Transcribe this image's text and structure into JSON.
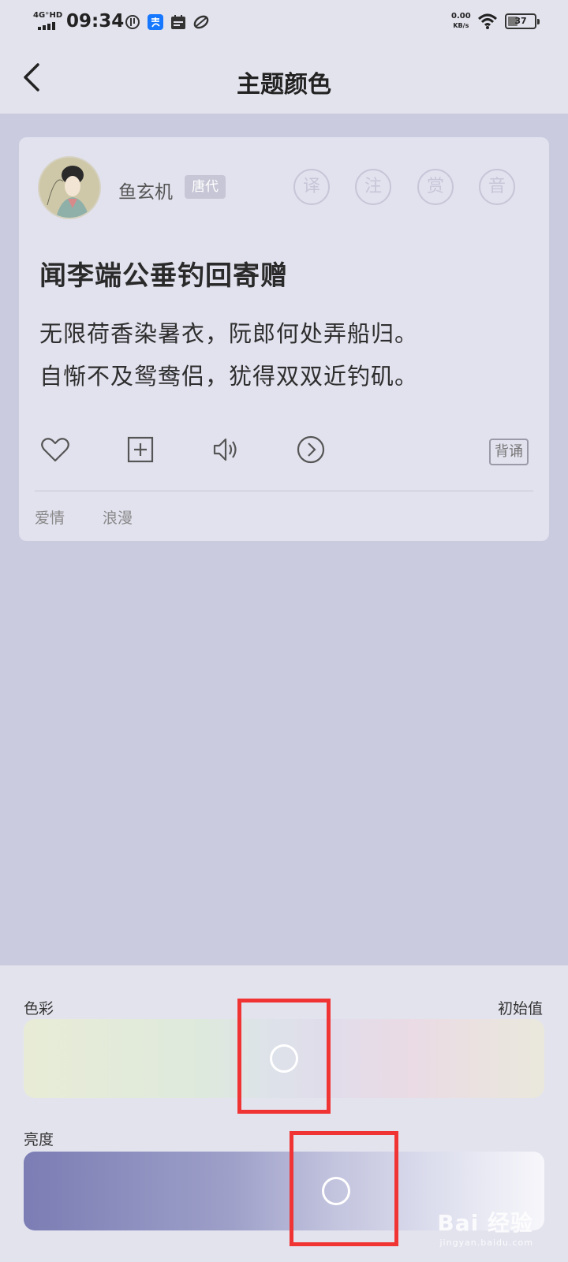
{
  "status_bar": {
    "network": "4G⁺HD",
    "time": "09:34",
    "net_speed_value": "0.00",
    "net_speed_unit": "KB/s",
    "battery": "37",
    "battery_level": 0.37,
    "icons": [
      "data-saver-icon",
      "alipay-icon",
      "calendar-icon",
      "app-icon",
      "wifi-icon",
      "battery-icon"
    ]
  },
  "nav": {
    "title": "主题颜色",
    "back_icon": "chevron-left-icon"
  },
  "card": {
    "author": "鱼玄机",
    "dynasty": "唐代",
    "tools": [
      "译",
      "注",
      "赏",
      "音"
    ],
    "poem_title": "闻李端公垂钓回寄赠",
    "lines": [
      "无限荷香染暑衣，阮郎何处弄船归。",
      "自惭不及鸳鸯侣，犹得双双近钓矶。"
    ],
    "actions": [
      "heart-icon",
      "add-box-icon",
      "speaker-icon",
      "next-circle-icon"
    ],
    "recite_label": "背诵",
    "tags": [
      "爱情",
      "浪漫"
    ]
  },
  "panel": {
    "color_label": "色彩",
    "reset_label": "初始值",
    "brightness_label": "亮度",
    "color_value": 0.5,
    "brightness_value": 0.6
  },
  "colors": {
    "background": "#cbcbdf",
    "surface": "#e3e3ee",
    "card": "#e2e2ef",
    "highlight": "#f03434"
  },
  "watermark": {
    "main": "Bai 经验",
    "sub": "jingyan.baidu.com"
  }
}
